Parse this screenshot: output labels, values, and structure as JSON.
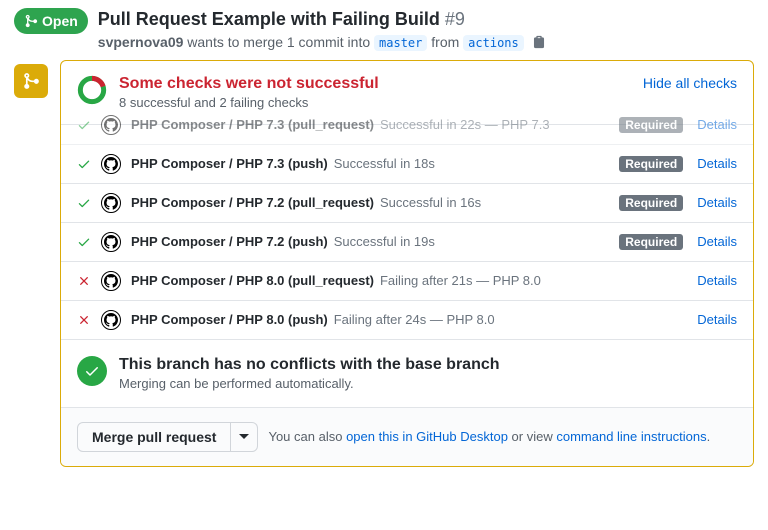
{
  "header": {
    "status_label": "Open",
    "title": "Pull Request Example with Failing Build",
    "number": "#9",
    "author": "svpernova09",
    "merge_text_1": "wants to merge 1 commit into",
    "base_branch": "master",
    "from_label": "from",
    "head_branch": "actions"
  },
  "checks_summary": {
    "title": "Some checks were not successful",
    "subtitle": "8 successful and 2 failing checks",
    "hide_link": "Hide all checks"
  },
  "checks": [
    {
      "status": "pass",
      "name": "PHP Composer / PHP 7.3 (pull_request)",
      "desc": "Successful in 22s — PHP 7.3",
      "required": true,
      "details": "Details"
    },
    {
      "status": "pass",
      "name": "PHP Composer / PHP 7.3 (push)",
      "desc": "Successful in 18s",
      "required": true,
      "details": "Details"
    },
    {
      "status": "pass",
      "name": "PHP Composer / PHP 7.2 (pull_request)",
      "desc": "Successful in 16s",
      "required": true,
      "details": "Details"
    },
    {
      "status": "pass",
      "name": "PHP Composer / PHP 7.2 (push)",
      "desc": "Successful in 19s",
      "required": true,
      "details": "Details"
    },
    {
      "status": "fail",
      "name": "PHP Composer / PHP 8.0 (pull_request)",
      "desc": "Failing after 21s — PHP 8.0",
      "required": false,
      "details": "Details"
    },
    {
      "status": "fail",
      "name": "PHP Composer / PHP 8.0 (push)",
      "desc": "Failing after 24s — PHP 8.0",
      "required": false,
      "details": "Details"
    }
  ],
  "required_label": "Required",
  "conflicts": {
    "title": "This branch has no conflicts with the base branch",
    "subtitle": "Merging can be performed automatically."
  },
  "merge": {
    "button": "Merge pull request",
    "text_1": "You can also ",
    "link_1": "open this in GitHub Desktop",
    "text_2": " or view ",
    "link_2": "command line instructions",
    "text_3": "."
  }
}
